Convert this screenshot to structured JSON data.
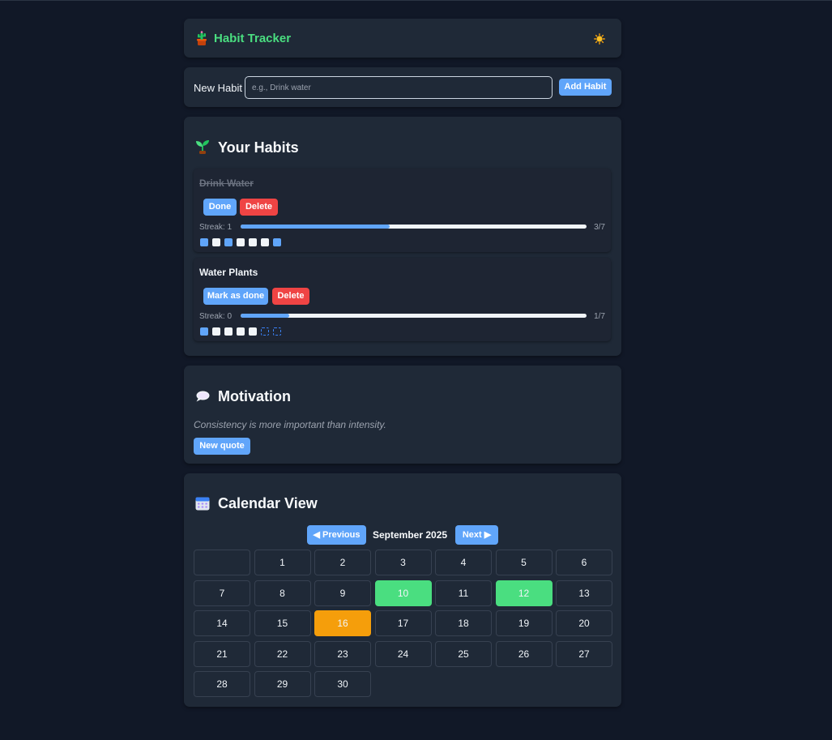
{
  "header": {
    "title": "Habit Tracker",
    "logo_icon": "cactus-pot-icon",
    "theme_icon": "sun-icon"
  },
  "new_habit": {
    "label": "New Habit",
    "placeholder": "e.g., Drink water",
    "value": "",
    "button": "Add Habit"
  },
  "habits_section": {
    "title": "Your Habits",
    "icon": "seedling-icon",
    "items": [
      {
        "name": "Drink Water",
        "completed_today": true,
        "primary_button": "Done",
        "delete_button": "Delete",
        "streak": "Streak: 1",
        "progress": 0.43,
        "count": "3/7",
        "week": [
          "on",
          "off",
          "on",
          "off",
          "off",
          "off",
          "on"
        ]
      },
      {
        "name": "Water Plants",
        "completed_today": false,
        "primary_button": "Mark as done",
        "delete_button": "Delete",
        "streak": "Streak: 0",
        "progress": 0.14,
        "count": "1/7",
        "week": [
          "on",
          "off",
          "off",
          "off",
          "off",
          "future",
          "future"
        ]
      }
    ]
  },
  "motivation": {
    "title": "Motivation",
    "icon": "speech-bubble-icon",
    "quote": "Consistency is more important than intensity.",
    "button": "New quote"
  },
  "calendar": {
    "title": "Calendar View",
    "icon": "calendar-icon",
    "prev_label": "◀ Previous",
    "next_label": "Next ▶",
    "month_label": "September 2025",
    "leading_blanks": 1,
    "days_in_month": 30,
    "completed_days": [
      10,
      12
    ],
    "today": 16
  },
  "colors": {
    "accent": "#60a5fa",
    "danger": "#ef4444",
    "success": "#4ade80",
    "today": "#f59e0b",
    "background": "#111827",
    "card": "#1f2937"
  }
}
